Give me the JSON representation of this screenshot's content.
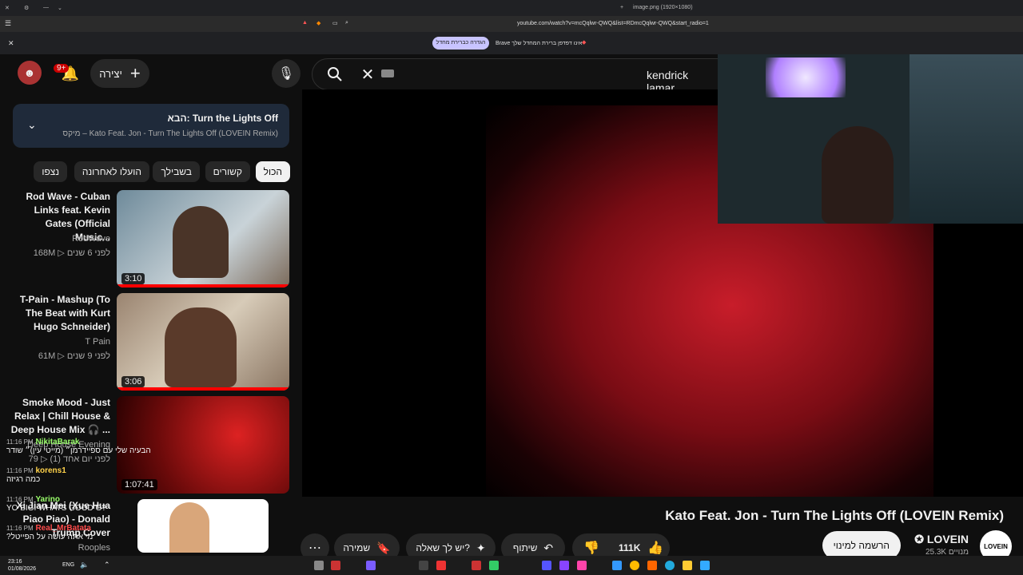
{
  "browser": {
    "tab_title": "image.png (1920×1080)",
    "url": "youtube.com/watch?v=mcQqlwr-QWQ&list=RDmcQqlwr-QWQ&start_radio=1",
    "info_message": "Brave אינו דפדפן ברירת המחדל שלך",
    "info_button": "הגדרה כברירת מחדל"
  },
  "header": {
    "notifications_badge": "9+",
    "create_label": "יצירה",
    "search_query": "kendrick lamar"
  },
  "up_next": {
    "label": "הבא: Turn the Lights Off",
    "subtitle": "מיקס – Kato Feat. Jon - Turn The Lights Off (LOVEIN Remix)"
  },
  "chips": [
    "הכול",
    "קשורים",
    "בשבילך",
    "הועלו לאחרונה",
    "נצפו"
  ],
  "recommendations": [
    {
      "title": "Rod Wave - Cuban Links feat. Kevin Gates (Official Music...",
      "channel": "RodWave",
      "views": "168M",
      "age": "לפני 6 שנים",
      "duration": "3:10"
    },
    {
      "title": "T-Pain - Mashup (To The Beat with Kurt Hugo Schneider)",
      "channel": "T Pain",
      "views": "61M",
      "age": "לפני 9 שנים",
      "duration": "3:06"
    },
    {
      "title": "Smoke Mood - Just Relax | Chill House & Deep House Mix 🎧 ...",
      "channel": "Deep House Evening",
      "views": "79",
      "age": "לפני יום אחד (1)",
      "duration": "1:07:41"
    },
    {
      "title": "Xi Jian Mei (Xue Hua Piao Piao) - Donald Trump Cover",
      "channel": "Rooples",
      "views": "",
      "age": "",
      "duration": ""
    }
  ],
  "chat": [
    {
      "time": "11:16 PM",
      "user": "NikitaBarak",
      "message": "הבעיה שלי עם ספיידרמן״ (מייטי עין)״ שודר",
      "color": "#9aff6b"
    },
    {
      "time": "11:16 PM",
      "user": "korens1",
      "message": "כמה רגיזה",
      "color": "#ffd24a"
    },
    {
      "time": "11:16 PM",
      "user": "Yarino",
      "message": "YO BIGI WHATS GOOD G?",
      "color": "#9aff6b"
    },
    {
      "time": "11:16 PM",
      "user": "Real_MrBatata",
      "message": "?מי אתה עושה על הפייטל",
      "color": "#ff4b4b"
    }
  ],
  "video": {
    "title": "Kato Feat. Jon - Turn The Lights Off (LOVEIN Remix)",
    "channel": "LOVEIN",
    "subscribers": "25.3K מנויים",
    "subscribe_label": "הרשמה למינוי",
    "likes": "111K",
    "share_label": "שיתוף",
    "ask_label": "יש לך שאלה?",
    "save_label": "שמירה",
    "channel_logo_text": "LOVEIN"
  },
  "taskbar": {
    "time": "23:16",
    "date": "01/08/2026",
    "lang": "ENG"
  },
  "colors": {
    "accent_red": "#ff0000",
    "brand_purple": "#c8c4ff",
    "next_card_bg": "#1f2a3a"
  }
}
